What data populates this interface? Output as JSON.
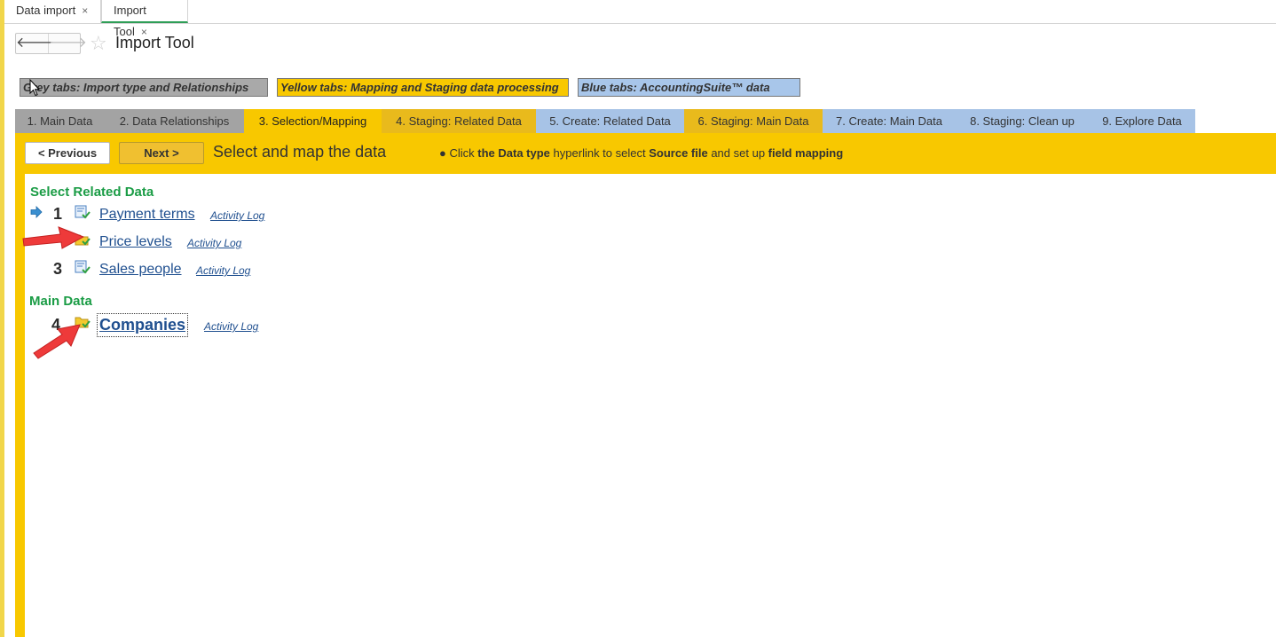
{
  "window_tabs": [
    {
      "label": "Data import",
      "close": "×"
    },
    {
      "label": "Import Tool",
      "close": "×"
    }
  ],
  "header": {
    "title": "Import Tool",
    "back": "🡐",
    "forward": "🡒",
    "favorite": "☆"
  },
  "legend": {
    "grey": "Grey tabs: Import type and Relationships",
    "yellow": "Yellow tabs: Mapping and Staging data processing",
    "blue": "Blue tabs: AccountingSuite™ data"
  },
  "steps": [
    {
      "label": "1. Main Data",
      "color": "grey"
    },
    {
      "label": "2. Data Relationships",
      "color": "grey"
    },
    {
      "label": "3. Selection/Mapping",
      "color": "active"
    },
    {
      "label": "4. Staging: Related Data",
      "color": "yellow"
    },
    {
      "label": "5. Create: Related Data",
      "color": "blue"
    },
    {
      "label": "6. Staging: Main Data",
      "color": "yellow"
    },
    {
      "label": "7. Create: Main Data",
      "color": "blue"
    },
    {
      "label": "8. Staging: Clean up",
      "color": "blue"
    },
    {
      "label": "9. Explore Data",
      "color": "blue"
    }
  ],
  "toolbar": {
    "prev": "< Previous",
    "next": "Next >",
    "title": "Select and map the data",
    "hint_bullet": "●",
    "hint_1": "Click",
    "hint_2": "the Data type",
    "hint_3": "hyperlink to select",
    "hint_4": "Source file",
    "hint_5": "and set up",
    "hint_6": "field mapping"
  },
  "related": {
    "heading": "Select Related Data",
    "items": [
      {
        "num": "1",
        "label": "Payment terms",
        "log": "Activity Log",
        "icon": "document-check-icon"
      },
      {
        "num": "",
        "label": "Price levels",
        "log": "Activity Log",
        "icon": "folder-check-icon"
      },
      {
        "num": "3",
        "label": "Sales people",
        "log": "Activity Log",
        "icon": "document-check-icon"
      }
    ]
  },
  "main": {
    "heading": "Main Data",
    "items": [
      {
        "num": "4",
        "label": "Companies",
        "log": "Activity Log",
        "icon": "folder-check-icon"
      }
    ]
  },
  "colors": {
    "accent_yellow": "#f8c800",
    "grey_tab": "#a3a3a3",
    "blue_tab": "#a7c3e6",
    "green_heading": "#1a9c45",
    "link": "#1f4f8f"
  }
}
